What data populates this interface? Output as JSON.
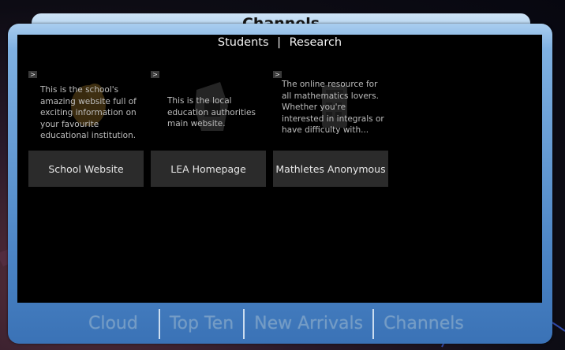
{
  "window": {
    "title": "Channels"
  },
  "tabs": {
    "students": "Students",
    "separator": "|",
    "research": "Research"
  },
  "cards": [
    {
      "arrow": ">",
      "description": "This is the school's amazing website full of exciting information on your favourite educational institution.",
      "name": "School Website"
    },
    {
      "arrow": ">",
      "description": "This is the local education authorities main website.",
      "name": "LEA Homepage"
    },
    {
      "arrow": ">",
      "description": "The online resource for all mathematics lovers. Whether you're interested in integrals or have difficulty with...",
      "name": "Mathletes Anonymous"
    }
  ],
  "bottom_nav": {
    "cloud": "Cloud",
    "top_ten": "Top Ten",
    "new_arrivals": "New Arrivals",
    "channels": "Channels"
  },
  "colors": {
    "frame": "#4d86c6",
    "panel": "#000000",
    "card_button": "#2b2b2b",
    "nav_text": "#7ea3c8"
  }
}
